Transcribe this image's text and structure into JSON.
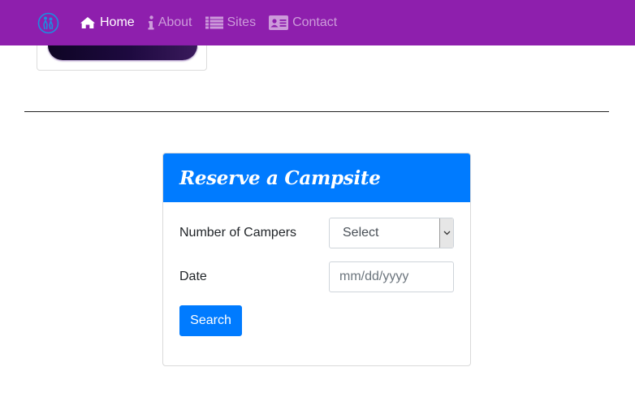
{
  "colors": {
    "navbar": "#8e1fad",
    "primary": "#007bff",
    "logo": "#1a8fe0"
  },
  "nav": {
    "brand_icon": "person-circle-logo-icon",
    "items": [
      {
        "label": "Home",
        "icon": "home-icon",
        "active": true
      },
      {
        "label": "About",
        "icon": "info-icon",
        "active": false
      },
      {
        "label": "Sites",
        "icon": "list-icon",
        "active": false
      },
      {
        "label": "Contact",
        "icon": "address-card-icon",
        "active": false
      }
    ]
  },
  "reserve": {
    "title": "Reserve a Campsite",
    "campers_label": "Number of Campers",
    "campers_selected": "Select",
    "date_label": "Date",
    "date_placeholder": "mm/dd/yyyy",
    "search_label": "Search"
  }
}
